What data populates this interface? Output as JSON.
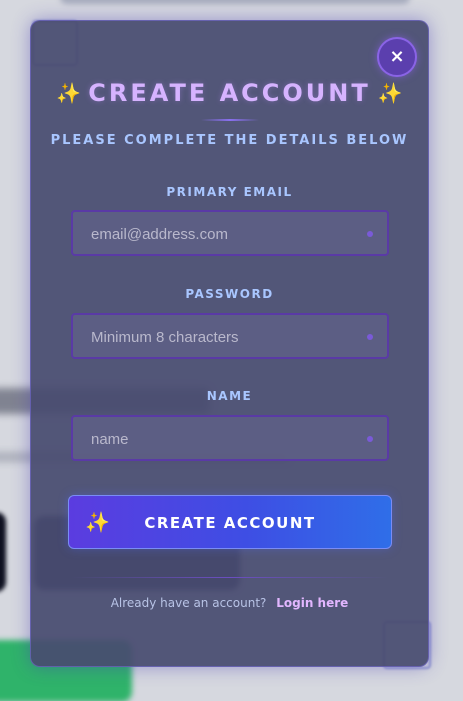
{
  "modal": {
    "title": "CREATE ACCOUNT",
    "title_decoration": "✨",
    "subtitle": "PLEASE COMPLETE THE DETAILS BELOW",
    "close_label": "×"
  },
  "form": {
    "fields": [
      {
        "label": "PRIMARY EMAIL",
        "placeholder": "email@address.com",
        "value": ""
      },
      {
        "label": "PASSWORD",
        "placeholder": "Minimum 8 characters",
        "value": ""
      },
      {
        "label": "NAME",
        "placeholder": "name",
        "value": ""
      }
    ],
    "submit_label": "CREATE ACCOUNT",
    "submit_icon": "✨"
  },
  "footer": {
    "prompt": "Already have an account?",
    "login_label": "Login here"
  },
  "colors": {
    "accent": "#d6b3ff",
    "label": "#a9c6ff",
    "button_start": "#5b3ce0",
    "button_end": "#2f6ee8"
  }
}
